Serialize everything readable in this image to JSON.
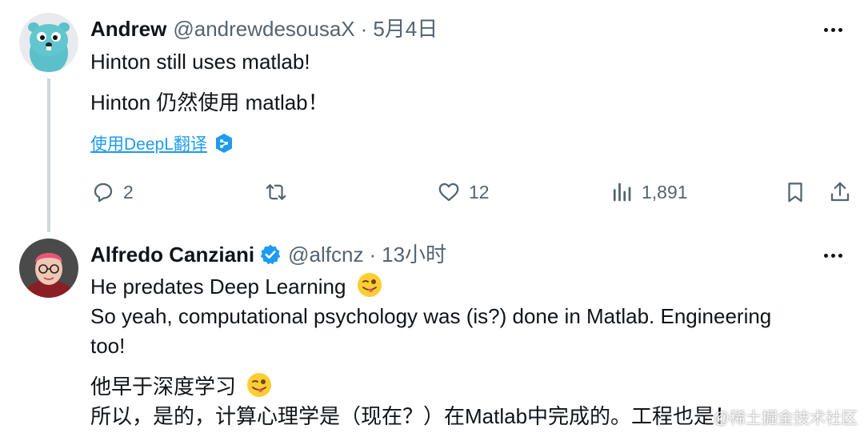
{
  "tweet1": {
    "name": "Andrew",
    "handle": "@andrewdesousaX",
    "dot": "·",
    "time": "5月4日",
    "text": "Hinton still uses matlab!",
    "translated": "Hinton 仍然使用 matlab！",
    "translate_link": "使用DeepL翻译",
    "actions": {
      "reply": "2",
      "retweet": "",
      "like": "12",
      "views": "1,891"
    }
  },
  "tweet2": {
    "name": "Alfredo Canziani",
    "handle": "@alfcnz",
    "dot": "·",
    "time": "13小时",
    "line1": "He predates Deep Learning",
    "line2": "So yeah, computational psychology was (is?) done in Matlab. Engineering",
    "line3": "too!",
    "zh1": "他早于深度学习",
    "zh2": "所以，是的，计算心理学是（现在？）在Matlab中完成的。工程也是！"
  },
  "watermark": "@稀土掘金技术社区",
  "colors": {
    "accent": "#1d9bf0",
    "muted": "#536471",
    "text": "#0f1419",
    "thread": "#cfd9de"
  },
  "icons": [
    "reply-icon",
    "retweet-icon",
    "like-icon",
    "views-icon",
    "bookmark-icon",
    "share-icon",
    "verified-badge-icon",
    "deepl-icon",
    "more-icon",
    "winking-tongue-emoji"
  ]
}
